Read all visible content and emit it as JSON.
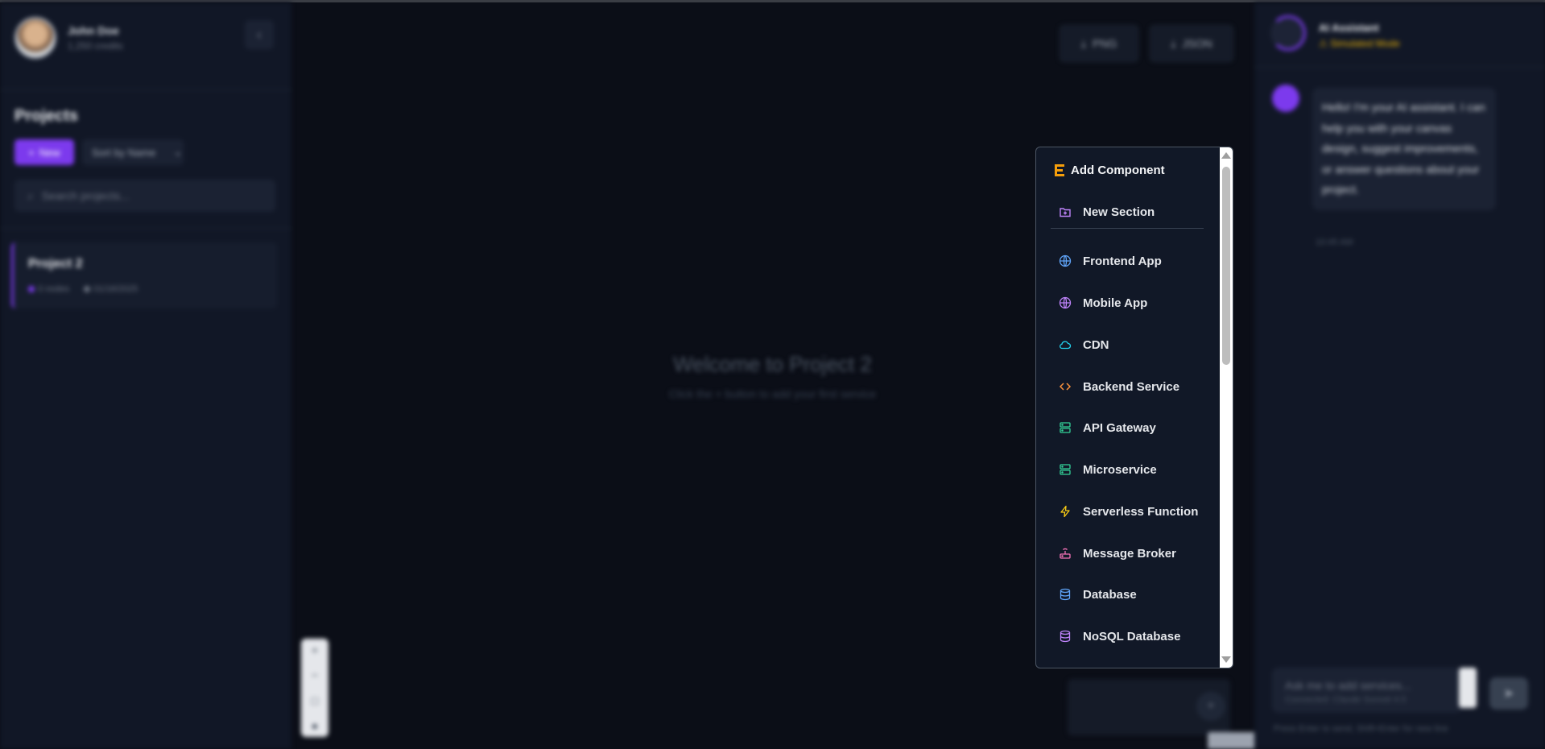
{
  "sidebar": {
    "user_name": "John Doe",
    "user_sub": "1,250 credits",
    "collapse_icon": "chevron-left-icon",
    "projects_title": "Projects",
    "new_button": "New",
    "sort_label": "Sort by Name",
    "search_placeholder": "Search projects...",
    "project": {
      "name": "Project 2",
      "meta1": "0 nodes",
      "meta2": "01/16/2025"
    }
  },
  "canvas": {
    "welcome_title": "Welcome to Project 2",
    "welcome_sub": "Click the + button to add your first service",
    "export_png": "PNG",
    "export_json": "JSON"
  },
  "dropdown": {
    "header": "Add Component",
    "header_icon_color": "#f59e0b",
    "items": [
      {
        "label": "New Section",
        "icon": "folder-plus-icon",
        "color": "#c084fc"
      },
      {
        "label": "Frontend App",
        "icon": "globe-icon",
        "color": "#60a5fa"
      },
      {
        "label": "Mobile App",
        "icon": "globe-icon",
        "color": "#c084fc"
      },
      {
        "label": "CDN",
        "icon": "cloud-icon",
        "color": "#22d3ee"
      },
      {
        "label": "Backend Service",
        "icon": "code-icon",
        "color": "#fb923c"
      },
      {
        "label": "API Gateway",
        "icon": "server-icon",
        "color": "#34d399"
      },
      {
        "label": "Microservice",
        "icon": "server-icon",
        "color": "#34d399"
      },
      {
        "label": "Serverless Function",
        "icon": "bolt-icon",
        "color": "#facc15"
      },
      {
        "label": "Message Broker",
        "icon": "router-icon",
        "color": "#f472b6"
      },
      {
        "label": "Database",
        "icon": "database-icon",
        "color": "#60a5fa"
      },
      {
        "label": "NoSQL Database",
        "icon": "database-icon",
        "color": "#c084fc"
      }
    ]
  },
  "assistant": {
    "title": "AI Assistant",
    "mode": "Simulated Mode",
    "message": "Hello! I'm your AI assistant. I can help you with your canvas design, suggest improvements, or answer questions about your project.",
    "time": "10:45 AM",
    "input_placeholder": "Ask me to add services...",
    "input_sub": "Connected: Claude Sonnet 4.5",
    "hint": "Press Enter to send, Shift+Enter for new line"
  },
  "colors": {
    "accent": "#7c3aed",
    "background": "#0b0e17",
    "panel": "#111726"
  }
}
